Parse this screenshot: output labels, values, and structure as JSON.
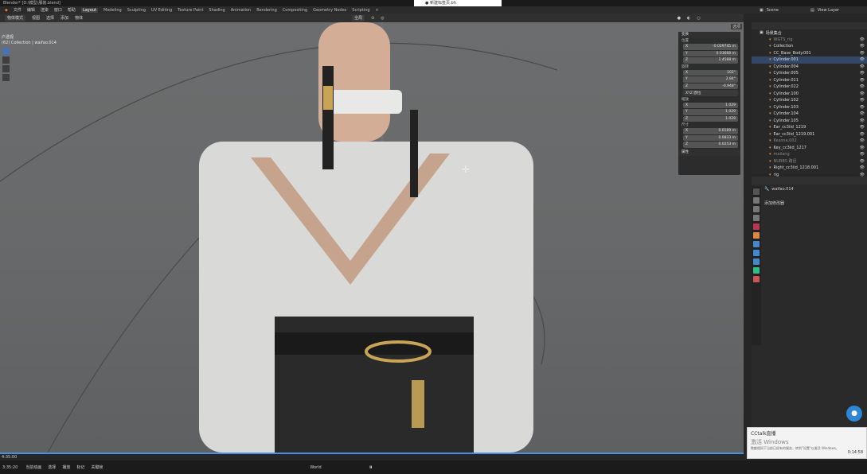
{
  "window": {
    "title": "Blender* [D:\\模型\\服装.blend]",
    "tab_label": "● 新建标签页.bh"
  },
  "menu": {
    "items": [
      "文件",
      "编辑",
      "渲染",
      "窗口",
      "帮助"
    ],
    "workspaces": [
      "Layout",
      "Modeling",
      "Sculpting",
      "UV Editing",
      "Texture Paint",
      "Shading",
      "Animation",
      "Rendering",
      "Compositing",
      "Geometry Nodes",
      "Scripting"
    ],
    "active_workspace": "Layout",
    "add_tab": "+"
  },
  "scene": {
    "scene_label": "Scene",
    "layer_label": "View Layer"
  },
  "header": {
    "mode": "物体模式",
    "view": "视图",
    "select": "选择",
    "add": "添加",
    "object": "物体",
    "orientation": "全局",
    "options": "选项"
  },
  "viewport": {
    "info_line1": "户透视",
    "info_line2": "(62) Collection | waifao.014"
  },
  "npanel": {
    "section_transform": "变换",
    "location_label": "位置",
    "location": [
      {
        "axis": "X",
        "value": "-0.029745 m"
      },
      {
        "axis": "Y",
        "value": "0.03668 m"
      },
      {
        "axis": "Z",
        "value": "1.4588 m"
      }
    ],
    "rotation_label": "旋转",
    "rotation": [
      {
        "axis": "X",
        "value": "102°"
      },
      {
        "axis": "Y",
        "value": "2.84°"
      },
      {
        "axis": "Z",
        "value": "-0.948°"
      }
    ],
    "rotation_mode": "XYZ 欧拉",
    "scale_label": "缩放",
    "scale": [
      {
        "axis": "X",
        "value": "1.029"
      },
      {
        "axis": "Y",
        "value": "1.029"
      },
      {
        "axis": "Z",
        "value": "1.029"
      }
    ],
    "dims_label": "尺寸",
    "dims": [
      {
        "axis": "X",
        "value": "0.0189 m"
      },
      {
        "axis": "Y",
        "value": "0.0833 m"
      },
      {
        "axis": "Z",
        "value": "0.0253 m"
      }
    ],
    "section_properties": "属性"
  },
  "outliner": {
    "title": "场景集合",
    "rows": [
      {
        "label": "WGTS_rig",
        "dim": true,
        "sel": false
      },
      {
        "label": "Collection",
        "dim": false,
        "sel": false
      },
      {
        "label": "CC_Base_Body.001",
        "dim": false,
        "sel": false
      },
      {
        "label": "Cylinder.001",
        "dim": false,
        "sel": true
      },
      {
        "label": "Cylinder.004",
        "dim": false,
        "sel": false
      },
      {
        "label": "Cylinder.005",
        "dim": false,
        "sel": false
      },
      {
        "label": "Cylinder.011",
        "dim": false,
        "sel": false
      },
      {
        "label": "Cylinder.022",
        "dim": false,
        "sel": false
      },
      {
        "label": "Cylinder.100",
        "dim": false,
        "sel": false
      },
      {
        "label": "Cylinder.102",
        "dim": false,
        "sel": false
      },
      {
        "label": "Cylinder.103",
        "dim": false,
        "sel": false
      },
      {
        "label": "Cylinder.104",
        "dim": false,
        "sel": false
      },
      {
        "label": "Cylinder.105",
        "dim": false,
        "sel": false
      },
      {
        "label": "Ear_cc3iid_1219",
        "dim": false,
        "sel": false
      },
      {
        "label": "Ear_cc3iid_1219.001",
        "dim": false,
        "sel": false
      },
      {
        "label": "Kesona.002",
        "dim": true,
        "sel": false
      },
      {
        "label": "Key_cc3iid_1217",
        "dim": false,
        "sel": false
      },
      {
        "label": "maiiang",
        "dim": true,
        "sel": false
      },
      {
        "label": "NURBS 路径",
        "dim": true,
        "sel": false
      },
      {
        "label": "Right_cc3iid_1218.001",
        "dim": false,
        "sel": false
      },
      {
        "label": "rig",
        "dim": false,
        "sel": false
      }
    ]
  },
  "properties": {
    "object_name": "waifao.014",
    "modifier_button": "添加修改器"
  },
  "toast": {
    "app": "CCtalk直播",
    "line1": "激活 Windows",
    "line2": "数额相同下当前已经有的服务，转到\"设置\"以激活 Windows。",
    "time": "0:14:58"
  },
  "timeline": {
    "frame": "4:35:00"
  },
  "statusbar": {
    "items": [
      "当前动画",
      "选择",
      "播放",
      "标记",
      "关键帧"
    ],
    "world": "World",
    "left_time": "3:35:20"
  },
  "colors": {
    "accent": "#4a90e2",
    "selected": "#334766",
    "viewport_bg": "#67696a"
  }
}
